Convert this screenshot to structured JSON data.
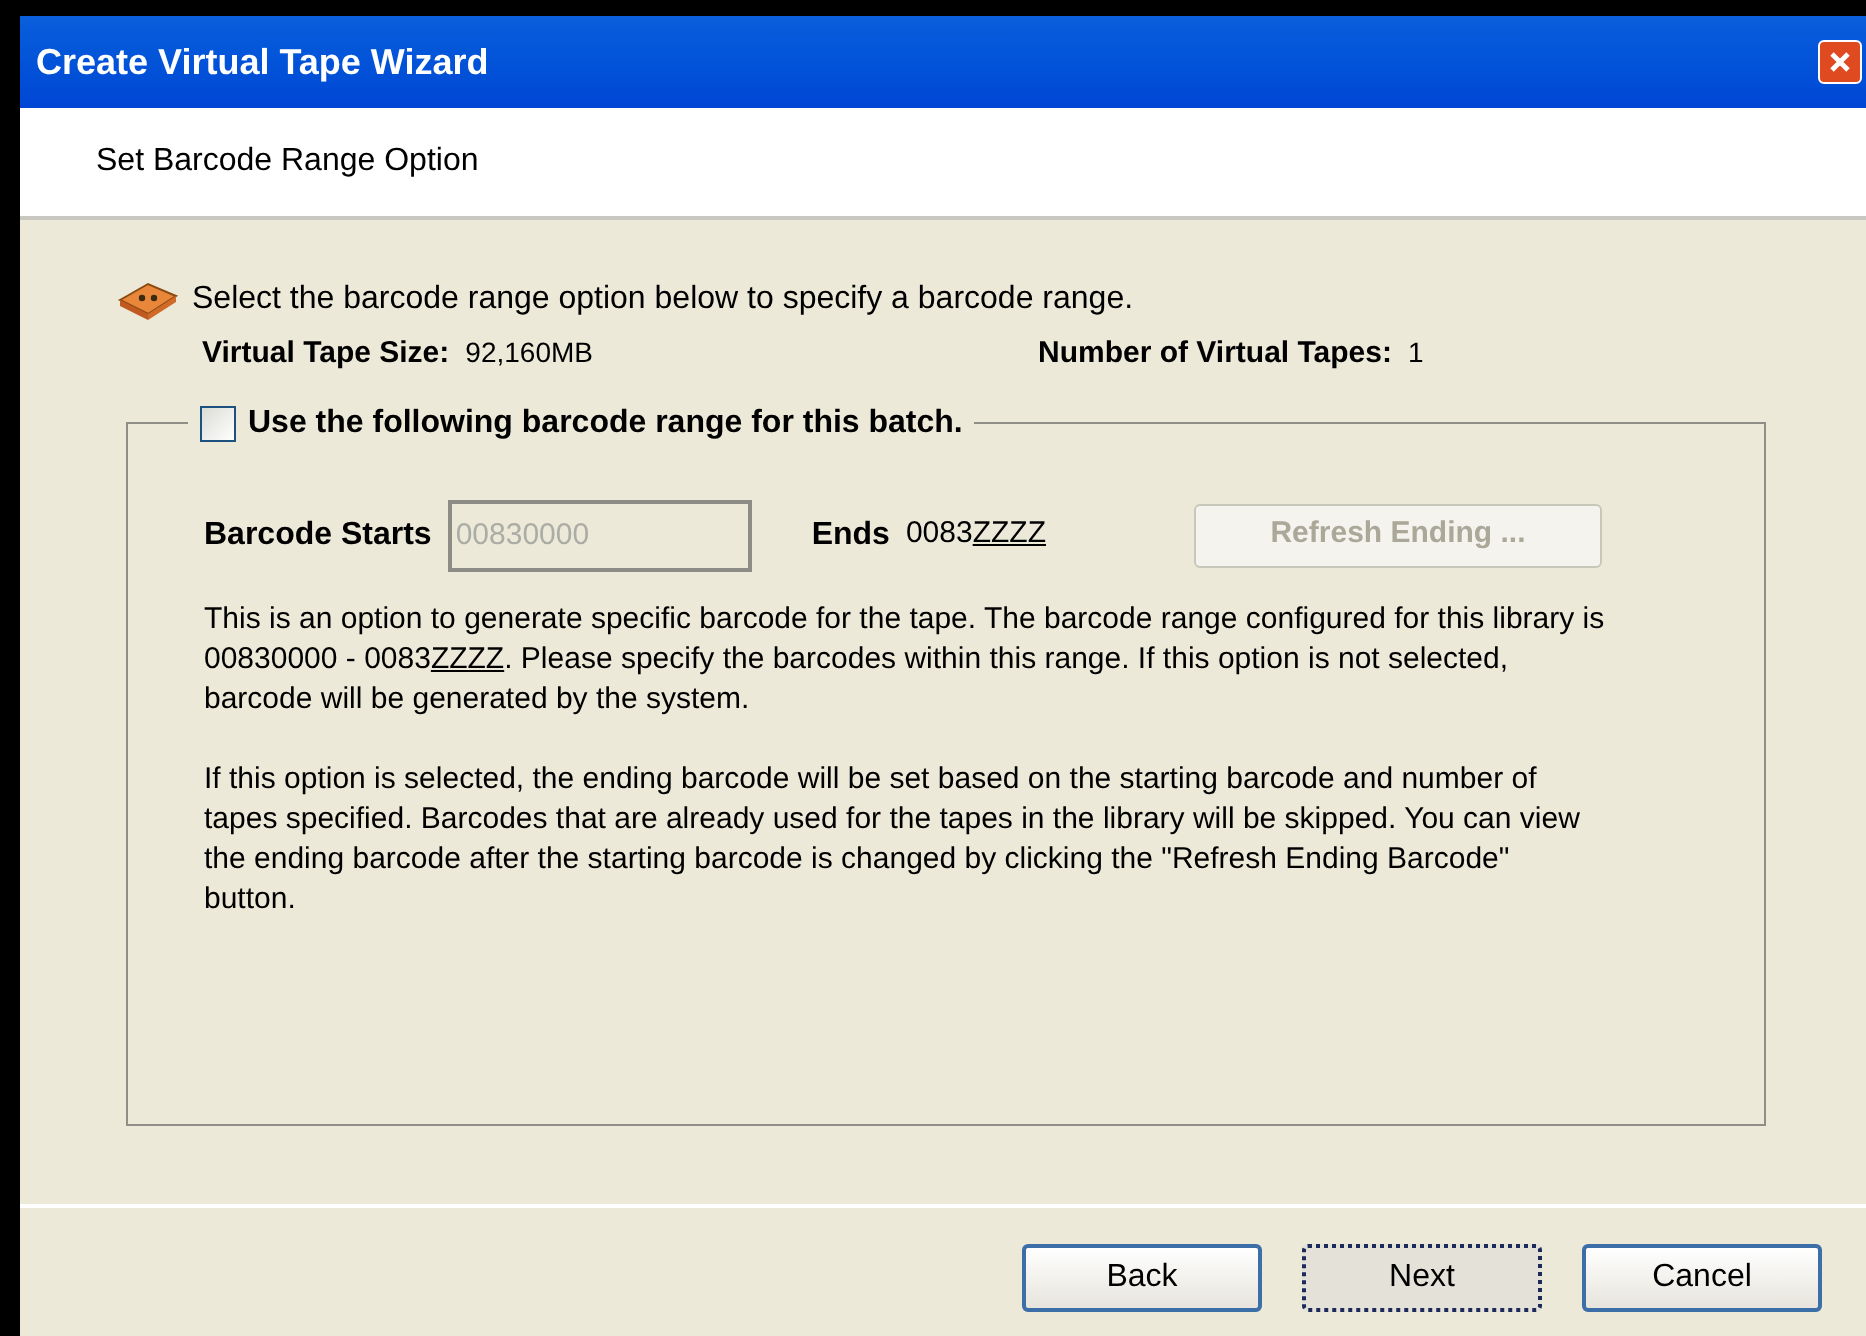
{
  "window": {
    "title": "Create Virtual Tape Wizard"
  },
  "header": {
    "title": "Set Barcode Range Option"
  },
  "intro": "Select the barcode range option below to specify a barcode range.",
  "info": [
    {
      "label": "Virtual Tape Size:",
      "value": "92,160MB"
    },
    {
      "label": "Number of Virtual Tapes:",
      "value": "1"
    }
  ],
  "range_group": {
    "checkbox": {
      "label": "Use the following barcode range for this batch.",
      "checked": false
    },
    "starts": {
      "label": "Barcode Starts",
      "value": "00830000",
      "disabled": true
    },
    "ends": {
      "label": "Ends",
      "value": [
        {
          "text": "0083",
          "underlined": false
        },
        {
          "text": "ZZZZ",
          "underlined": true
        }
      ]
    },
    "refresh_button": {
      "label": "Refresh Ending ...",
      "disabled": true
    },
    "paragraphs": [
      [
        {
          "text": "This is an option to generate specific barcode for the tape. The barcode range configured for this library is 00830000 - 0083",
          "underlined": false
        },
        {
          "text": "ZZZZ",
          "underlined": true
        },
        {
          "text": ". Please specify the barcodes within this range. If this option is not selected, barcode will be generated by the system.",
          "underlined": false
        }
      ],
      [
        {
          "text": "If this option is selected, the ending barcode will be set based on the starting barcode and number of tapes specified. Barcodes that are already used for the tapes in the library will be skipped. You can view the ending barcode after the starting barcode is changed by clicking the \"Refresh Ending Barcode\" button.",
          "underlined": false
        }
      ]
    ]
  },
  "buttons": [
    {
      "label": "Back",
      "focused": false
    },
    {
      "label": "Next",
      "focused": true
    },
    {
      "label": "Cancel",
      "focused": false
    }
  ]
}
